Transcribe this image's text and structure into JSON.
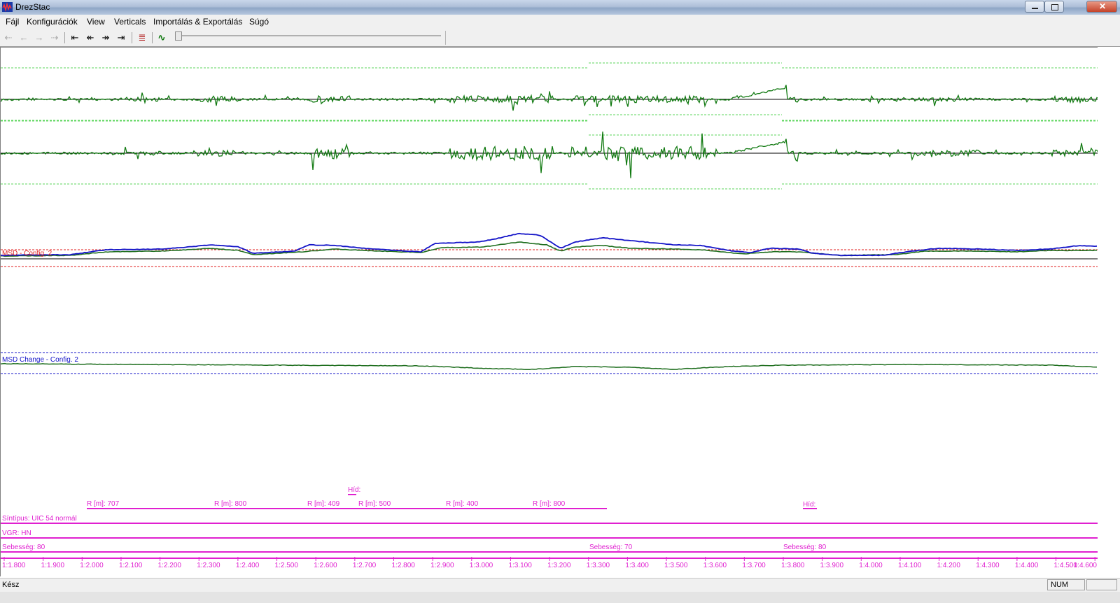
{
  "window": {
    "title": "DrezStac"
  },
  "menu": [
    "Fájl",
    "Konfigurációk",
    "View",
    "Verticals",
    "Importálás & Exportálás",
    "Súgó"
  ],
  "toolbar": {
    "buttons": [
      {
        "name": "back-disabled-icon",
        "glyph": "⇠"
      },
      {
        "name": "back-small-disabled-icon",
        "glyph": "←"
      },
      {
        "name": "forward-small-disabled-icon",
        "glyph": "→"
      },
      {
        "name": "forward-disabled-icon",
        "glyph": "⇢"
      },
      {
        "name": "jump-start-icon",
        "glyph": "⇤"
      },
      {
        "name": "step-back-icon",
        "glyph": "↞"
      },
      {
        "name": "step-forward-icon",
        "glyph": "↠"
      },
      {
        "name": "jump-end-icon",
        "glyph": "⇥"
      },
      {
        "name": "track-settings-icon",
        "glyph": "≣"
      },
      {
        "name": "signal-view-icon",
        "glyph": "∿"
      }
    ]
  },
  "channels": [
    {
      "label": "",
      "color": "#127a12"
    },
    {
      "label": "",
      "color": "#127a12"
    }
  ],
  "msd": {
    "label": "MSD - Config. 2",
    "colors": {
      "primary": "#1414c8",
      "secondary": "#1e6e1e",
      "threshold": "#e01e1e"
    }
  },
  "msd_change": {
    "label": "MSD Change - Config. 2",
    "colors": {
      "line": "#1e6e1e",
      "threshold": "#1414c8"
    }
  },
  "annotations": {
    "color": "#e020d0",
    "curves": [
      {
        "text": "R [m]: 707"
      },
      {
        "text": "R [m]: 800"
      },
      {
        "text": "R [m]: 409"
      },
      {
        "text": "R [m]: 500"
      },
      {
        "text": "R [m]: 400"
      },
      {
        "text": "R [m]: 800"
      }
    ],
    "bridges": [
      {
        "text": "Híd:"
      },
      {
        "text": "Híd:"
      }
    ],
    "rail_type": "Síntípus: UIC 54 normál",
    "vgr": "VGR: HN",
    "speeds": [
      {
        "text": "Sebesség: 80"
      },
      {
        "text": "Sebesség: 70"
      },
      {
        "text": "Sebesség: 80"
      }
    ],
    "axis_ticks": [
      "1:1.800",
      "1:1.900",
      "1:2.000",
      "1:2.100",
      "1:2.200",
      "1:2.300",
      "1:2.400",
      "1:2.500",
      "1:2.600",
      "1:2.700",
      "1:2.800",
      "1:2.900",
      "1:3.000",
      "1:3.100",
      "1:3.200",
      "1:3.300",
      "1:3.400",
      "1:3.500",
      "1:3.600",
      "1:3.700",
      "1:3.800",
      "1:3.900",
      "1:4.000",
      "1:4.100",
      "1:4.200",
      "1:4.300",
      "1:4.400",
      "1:4.500",
      "1:4.600"
    ]
  },
  "status": {
    "text": "Kész",
    "num": "NUM"
  }
}
